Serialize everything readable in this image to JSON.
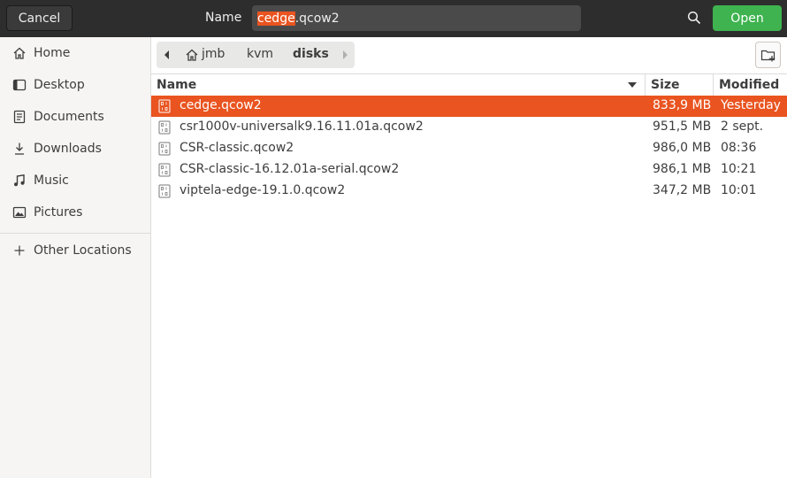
{
  "header": {
    "cancel_label": "Cancel",
    "name_label": "Name",
    "name_selected": "cedge",
    "name_rest": ".qcow2",
    "open_label": "Open",
    "accent": "#e95420",
    "open_color": "#3eb34f"
  },
  "sidebar": {
    "items": [
      {
        "label": "Home",
        "icon": "home-icon"
      },
      {
        "label": "Desktop",
        "icon": "desktop-icon"
      },
      {
        "label": "Documents",
        "icon": "documents-icon"
      },
      {
        "label": "Downloads",
        "icon": "downloads-icon"
      },
      {
        "label": "Music",
        "icon": "music-icon"
      },
      {
        "label": "Pictures",
        "icon": "pictures-icon"
      },
      {
        "label": "Other Locations",
        "icon": "plus-icon"
      }
    ]
  },
  "pathbar": {
    "crumbs": [
      "jmb",
      "kvm",
      "disks"
    ]
  },
  "columns": {
    "name": "Name",
    "size": "Size",
    "modified": "Modified"
  },
  "files": [
    {
      "name": "cedge.qcow2",
      "size": "833,9 MB",
      "modified": "Yesterday",
      "selected": true
    },
    {
      "name": "csr1000v-universalk9.16.11.01a.qcow2",
      "size": "951,5 MB",
      "modified": "2 sept.",
      "selected": false
    },
    {
      "name": "CSR-classic.qcow2",
      "size": "986,0 MB",
      "modified": "08:36",
      "selected": false
    },
    {
      "name": "CSR-classic-16.12.01a-serial.qcow2",
      "size": "986,1 MB",
      "modified": "10:21",
      "selected": false
    },
    {
      "name": "viptela-edge-19.1.0.qcow2",
      "size": "347,2 MB",
      "modified": "10:01",
      "selected": false
    }
  ]
}
